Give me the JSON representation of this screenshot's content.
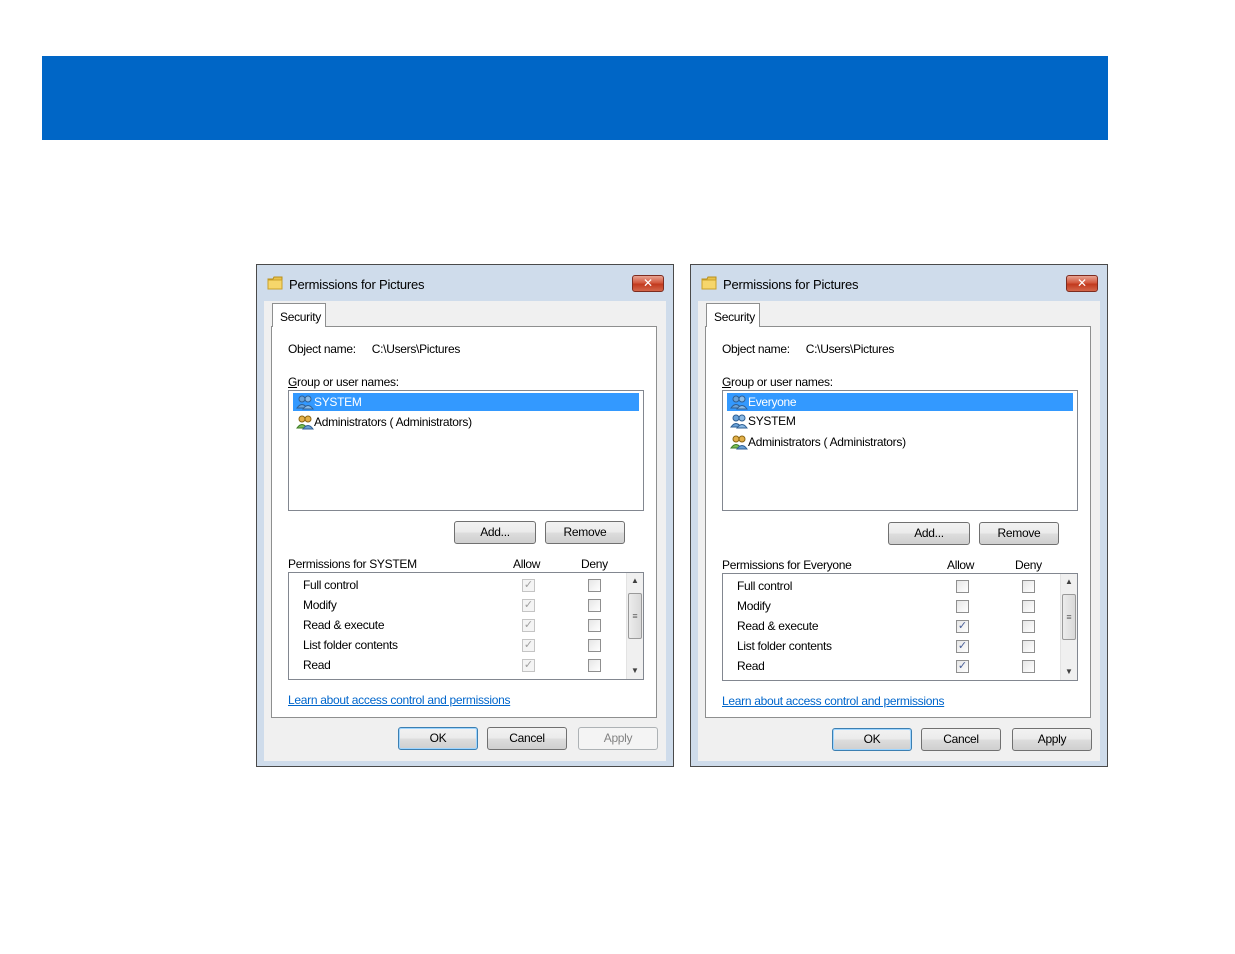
{
  "colors": {
    "banner": "#0066c6",
    "selection": "#3399ff",
    "link": "#0066cc"
  },
  "dialogs": [
    {
      "title": "Permissions for Pictures",
      "close_symbol": "✕",
      "tab": "Security",
      "object_name_label": "Object name:",
      "object_name_value": "C:\\Users\\Pictures",
      "group_label_mnemonic": "G",
      "group_label_rest": "roup or user names:",
      "users": [
        {
          "name": "SYSTEM",
          "selected": true,
          "icon": "users-group-icon"
        },
        {
          "name": "Administrators ( Administrators)",
          "selected": false,
          "icon": "admin-group-icon"
        }
      ],
      "add_button": "Add...",
      "remove_button": "Remove",
      "permissions_label": "Permissions for SYSTEM",
      "allow_header": "Allow",
      "deny_header": "Deny",
      "permissions": [
        {
          "name": "Full control",
          "allow": true,
          "allow_inherited": true,
          "deny": false
        },
        {
          "name": "Modify",
          "allow": true,
          "allow_inherited": true,
          "deny": false
        },
        {
          "name": "Read & execute",
          "allow": true,
          "allow_inherited": true,
          "deny": false
        },
        {
          "name": "List folder contents",
          "allow": true,
          "allow_inherited": true,
          "deny": false
        },
        {
          "name": "Read",
          "allow": true,
          "allow_inherited": true,
          "deny": false
        }
      ],
      "learn_link": "Learn about access control and permissions",
      "ok_button": "OK",
      "cancel_button": "Cancel",
      "apply_button": "Apply",
      "apply_enabled": false
    },
    {
      "title": "Permissions for Pictures",
      "close_symbol": "✕",
      "tab": "Security",
      "object_name_label": "Object name:",
      "object_name_value": "C:\\Users\\Pictures",
      "group_label_mnemonic": "G",
      "group_label_rest": "roup or user names:",
      "users": [
        {
          "name": "Everyone",
          "selected": true,
          "icon": "users-group-icon"
        },
        {
          "name": "SYSTEM",
          "selected": false,
          "icon": "users-group-icon"
        },
        {
          "name": "Administrators ( Administrators)",
          "selected": false,
          "icon": "admin-group-icon"
        }
      ],
      "add_button": "Add...",
      "remove_button": "Remove",
      "permissions_label": "Permissions for Everyone",
      "allow_header": "Allow",
      "deny_header": "Deny",
      "permissions": [
        {
          "name": "Full control",
          "allow": false,
          "allow_inherited": false,
          "deny": false
        },
        {
          "name": "Modify",
          "allow": false,
          "allow_inherited": false,
          "deny": false
        },
        {
          "name": "Read & execute",
          "allow": true,
          "allow_inherited": false,
          "deny": false
        },
        {
          "name": "List folder contents",
          "allow": true,
          "allow_inherited": false,
          "deny": false
        },
        {
          "name": "Read",
          "allow": true,
          "allow_inherited": false,
          "deny": false
        }
      ],
      "learn_link": "Learn about access control and permissions",
      "ok_button": "OK",
      "cancel_button": "Cancel",
      "apply_button": "Apply",
      "apply_enabled": true
    }
  ]
}
